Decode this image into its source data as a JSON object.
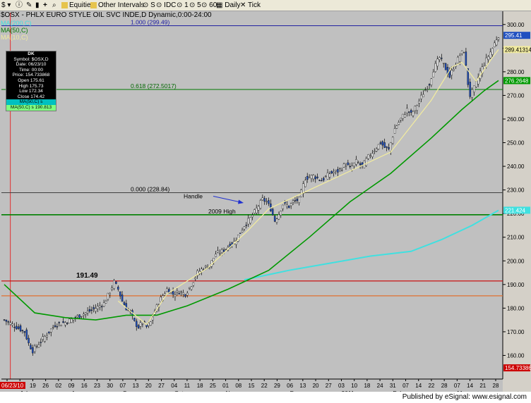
{
  "toolbar": {
    "symbol_menu": "$",
    "equities": "Equities",
    "other_intervals": "Other Intervals",
    "s": "S",
    "idc": "IDC",
    "i1": "1",
    "i5": "5",
    "i60": "60",
    "daily": "Daily",
    "tick": "Tick"
  },
  "header": {
    "title": "$OSX - PHLX EURO STYLE OIL SVC INDE,D  Dynamic,0:00-24:00"
  },
  "legend": {
    "ma200": "MA(200,C)",
    "ma50": "MA(50,C)",
    "ma10": "MA(10,C)"
  },
  "databox": {
    "head": "DK",
    "symbol": "Symbol: $OSX,D",
    "date": "Date: 06/23/10",
    "time": "Time: 00:00",
    "price": "Price: 154.733868",
    "open": "Open 175.61",
    "high": "High 175.73",
    "low": "Low 172.34",
    "close": "Close 174.42",
    "ma50": "MA(50,C) s",
    "ma10": "MA(50,C) s 190.813"
  },
  "annotations": {
    "fib_top": "1.000 (299.49)",
    "fib_mid": "0.618 (272.5017)",
    "fib_bottom": "0.000 (228.84)",
    "handle": "Handle",
    "high2009": "2009 High",
    "peak": "191.49"
  },
  "price_labels": {
    "last": "295.41",
    "ma10": "289.41314",
    "ma50": "276.2648",
    "ma200": "221.424",
    "cursor": "154.73386"
  },
  "cursor_date": "06/23/10",
  "footer": {
    "credit": "Published by eSignal: www.esignal.com"
  },
  "colors": {
    "background": "#c0c0c0",
    "ma10": "#f0eaa0",
    "ma50": "#009900",
    "ma200": "#40e0e0",
    "fib": "#007700",
    "level_red": "#cc0000",
    "level_orange": "#e07030"
  },
  "chart_data": {
    "type": "candlestick",
    "ylim": [
      150,
      305
    ],
    "yticks": [
      160,
      170,
      180,
      190,
      200,
      210,
      220,
      230,
      240,
      250,
      260,
      270,
      280,
      290,
      300
    ],
    "x_day_labels": [
      "06",
      "12",
      "19",
      "26",
      "02",
      "09",
      "16",
      "23",
      "30",
      "07",
      "13",
      "20",
      "27",
      "04",
      "11",
      "18",
      "25",
      "01",
      "08",
      "15",
      "22",
      "29",
      "06",
      "13",
      "20",
      "27",
      "03",
      "10",
      "18",
      "24",
      "31",
      "07",
      "14",
      "22",
      "28",
      "07",
      "14",
      "21",
      "28"
    ],
    "x_month_labels": [
      "Jul",
      "Aug",
      "Sep",
      "Oct",
      "Nov",
      "Dec",
      "2011",
      "Feb",
      "Mar"
    ],
    "horizontal_levels": [
      {
        "name": "fib_1.000",
        "value": 299.49
      },
      {
        "name": "fib_0.618",
        "value": 272.5017
      },
      {
        "name": "fib_0.000",
        "value": 228.84
      },
      {
        "name": "2009 High",
        "value": 219.5
      },
      {
        "name": "red_level",
        "value": 191.49
      },
      {
        "name": "orange_level",
        "value": 185.2
      }
    ],
    "close_path": [
      [
        0,
        175
      ],
      [
        6,
        172
      ],
      [
        10,
        170
      ],
      [
        12,
        165
      ],
      [
        14,
        162
      ],
      [
        16,
        164
      ],
      [
        20,
        168
      ],
      [
        25,
        173
      ],
      [
        30,
        174
      ],
      [
        35,
        176
      ],
      [
        40,
        178
      ],
      [
        45,
        180
      ],
      [
        49,
        182
      ],
      [
        52,
        187
      ],
      [
        54,
        191
      ],
      [
        56,
        188
      ],
      [
        58,
        183
      ],
      [
        60,
        180
      ],
      [
        62,
        178
      ],
      [
        64,
        174
      ],
      [
        66,
        172
      ],
      [
        68,
        174
      ],
      [
        70,
        172
      ],
      [
        72,
        174
      ],
      [
        74,
        179
      ],
      [
        77,
        184
      ],
      [
        80,
        188
      ],
      [
        83,
        186
      ],
      [
        86,
        187
      ],
      [
        89,
        186
      ],
      [
        92,
        190
      ],
      [
        95,
        195
      ],
      [
        98,
        197
      ],
      [
        101,
        198
      ],
      [
        104,
        203
      ],
      [
        107,
        204
      ],
      [
        110,
        206
      ],
      [
        113,
        208
      ],
      [
        116,
        212
      ],
      [
        118,
        215
      ],
      [
        121,
        218
      ],
      [
        124,
        222
      ],
      [
        127,
        226
      ],
      [
        129,
        225
      ],
      [
        131,
        222
      ],
      [
        133,
        217
      ],
      [
        135,
        220
      ],
      [
        137,
        224
      ],
      [
        140,
        223
      ],
      [
        142,
        225
      ],
      [
        145,
        226
      ],
      [
        148,
        235
      ],
      [
        152,
        236
      ],
      [
        156,
        234
      ],
      [
        160,
        237
      ],
      [
        164,
        238
      ],
      [
        168,
        241
      ],
      [
        170,
        239
      ],
      [
        173,
        242
      ],
      [
        176,
        240
      ],
      [
        179,
        244
      ],
      [
        182,
        247
      ],
      [
        185,
        250
      ],
      [
        187,
        248
      ],
      [
        189,
        247
      ],
      [
        192,
        256
      ],
      [
        195,
        260
      ],
      [
        198,
        264
      ],
      [
        200,
        262
      ],
      [
        203,
        266
      ],
      [
        206,
        271
      ],
      [
        209,
        275
      ],
      [
        211,
        281
      ],
      [
        214,
        286
      ],
      [
        216,
        283
      ],
      [
        219,
        278
      ],
      [
        221,
        282
      ],
      [
        224,
        287
      ],
      [
        226,
        289
      ],
      [
        228,
        275
      ],
      [
        229,
        270
      ],
      [
        231,
        273
      ],
      [
        234,
        280
      ],
      [
        237,
        285
      ],
      [
        240,
        290
      ],
      [
        242,
        294
      ],
      [
        243,
        295.4
      ]
    ],
    "ma10_path": [
      [
        56,
        183
      ],
      [
        70,
        173
      ],
      [
        80,
        186
      ],
      [
        100,
        197
      ],
      [
        120,
        213
      ],
      [
        130,
        222
      ],
      [
        150,
        230
      ],
      [
        170,
        238
      ],
      [
        190,
        246
      ],
      [
        210,
        268
      ],
      [
        220,
        282
      ],
      [
        225,
        284
      ],
      [
        232,
        276
      ],
      [
        240,
        286
      ],
      [
        243,
        289.4
      ]
    ],
    "ma50_path": [
      [
        0,
        190
      ],
      [
        15,
        178
      ],
      [
        30,
        176
      ],
      [
        45,
        175
      ],
      [
        60,
        177
      ],
      [
        75,
        177
      ],
      [
        90,
        181
      ],
      [
        110,
        188
      ],
      [
        130,
        196
      ],
      [
        150,
        210
      ],
      [
        170,
        225
      ],
      [
        190,
        237
      ],
      [
        210,
        252
      ],
      [
        225,
        264
      ],
      [
        236,
        272
      ],
      [
        243,
        276.3
      ]
    ],
    "ma200_path": [
      [
        118,
        192
      ],
      [
        140,
        196
      ],
      [
        160,
        199
      ],
      [
        180,
        202
      ],
      [
        200,
        204
      ],
      [
        215,
        209
      ],
      [
        230,
        215
      ],
      [
        243,
        221.4
      ]
    ],
    "n_bars": 244,
    "last_price": 295.41,
    "cursor_price": 154.73386
  }
}
